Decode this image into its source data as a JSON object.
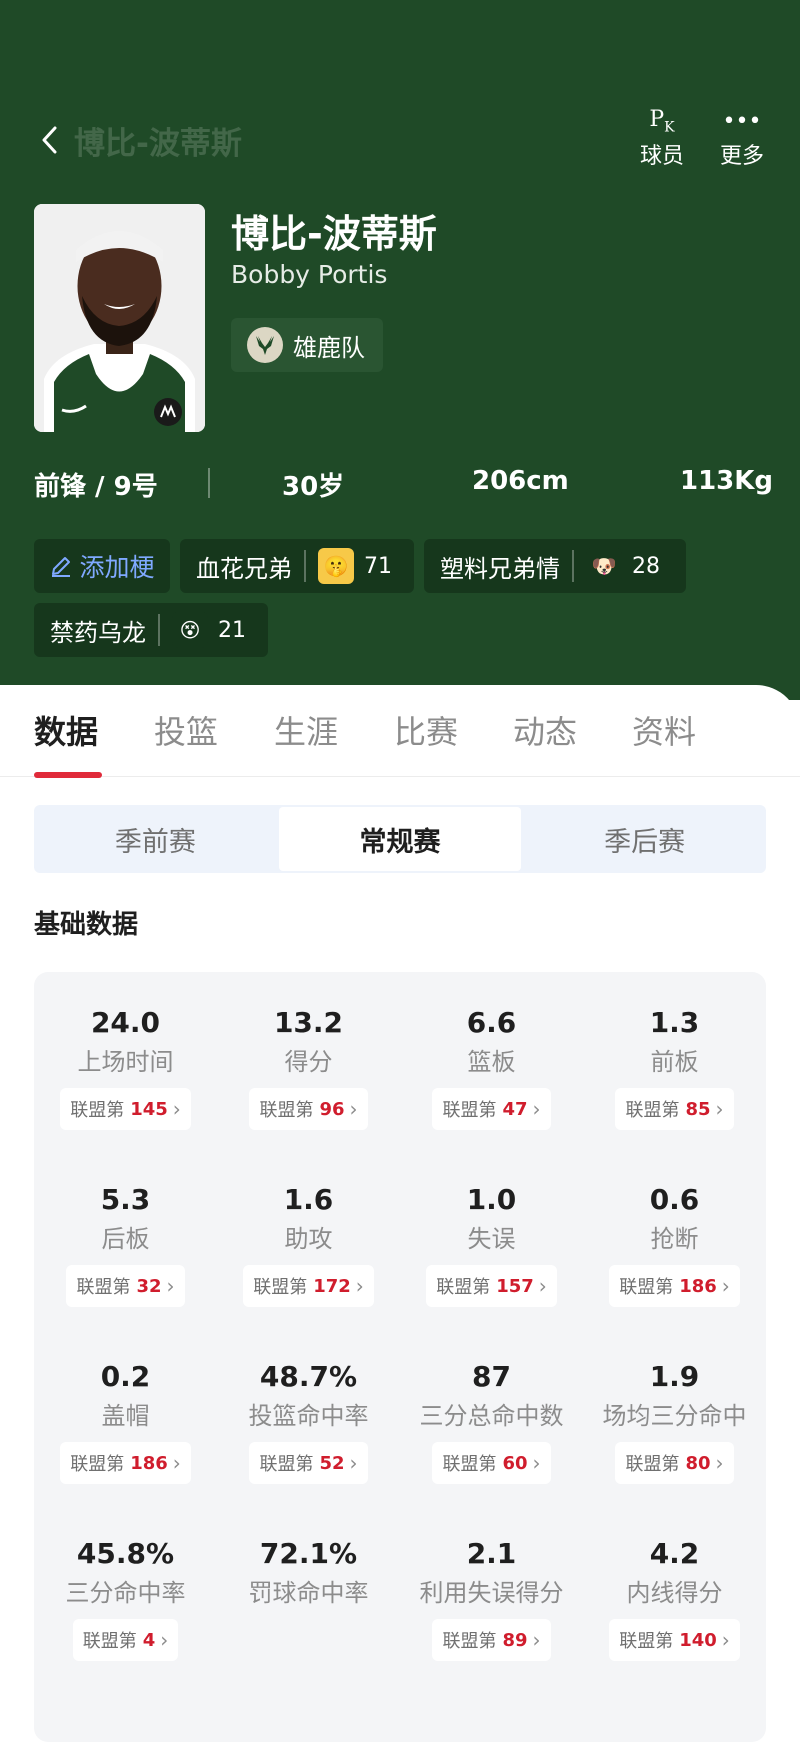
{
  "header": {
    "nav_title": "博比-波蒂斯",
    "pk_label": "球员",
    "more_label": "更多",
    "more_icon": "•••"
  },
  "player": {
    "name_cn": "博比-波蒂斯",
    "name_en": "Bobby Portis",
    "team": "雄鹿队",
    "position_number": "前锋 / 9号",
    "age": "30岁",
    "height": "206cm",
    "weight": "113Kg"
  },
  "tags": {
    "add_label": "添加梗",
    "items": [
      {
        "label": "血花兄弟",
        "count": "71",
        "emoji": "🤫",
        "emoji_icon": "shush-face-icon"
      },
      {
        "label": "塑料兄弟情",
        "count": "28",
        "emoji": "🐶",
        "emoji_icon": "shiba-dog-icon"
      },
      {
        "label": "禁药乌龙",
        "count": "21",
        "emoji": "😵",
        "emoji_icon": "dizzy-face-icon"
      }
    ]
  },
  "tabs": [
    "数据",
    "投篮",
    "生涯",
    "比赛",
    "动态",
    "资料"
  ],
  "season_types": [
    "季前赛",
    "常规赛",
    "季后赛"
  ],
  "section_title": "基础数据",
  "rank_prefix": "联盟第",
  "stats": [
    {
      "value": "24.0",
      "label": "上场时间",
      "rank": "145"
    },
    {
      "value": "13.2",
      "label": "得分",
      "rank": "96"
    },
    {
      "value": "6.6",
      "label": "篮板",
      "rank": "47"
    },
    {
      "value": "1.3",
      "label": "前板",
      "rank": "85"
    },
    {
      "value": "5.3",
      "label": "后板",
      "rank": "32"
    },
    {
      "value": "1.6",
      "label": "助攻",
      "rank": "172"
    },
    {
      "value": "1.0",
      "label": "失误",
      "rank": "157"
    },
    {
      "value": "0.6",
      "label": "抢断",
      "rank": "186"
    },
    {
      "value": "0.2",
      "label": "盖帽",
      "rank": "186"
    },
    {
      "value": "48.7%",
      "label": "投篮命中率",
      "rank": "52"
    },
    {
      "value": "87",
      "label": "三分总命中数",
      "rank": "60"
    },
    {
      "value": "1.9",
      "label": "场均三分命中",
      "rank": "80"
    },
    {
      "value": "45.8%",
      "label": "三分命中率",
      "rank": "4"
    },
    {
      "value": "72.1%",
      "label": "罚球命中率",
      "rank": null
    },
    {
      "value": "2.1",
      "label": "利用失误得分",
      "rank": "89"
    },
    {
      "value": "4.2",
      "label": "内线得分",
      "rank": "140"
    }
  ],
  "colors": {
    "header_bg": "#1f4a27",
    "tag_bg": "#16371c",
    "accent_red": "#e02a3a",
    "rank_red": "#d01d2d",
    "add_tag_blue": "#7fa9ff"
  }
}
